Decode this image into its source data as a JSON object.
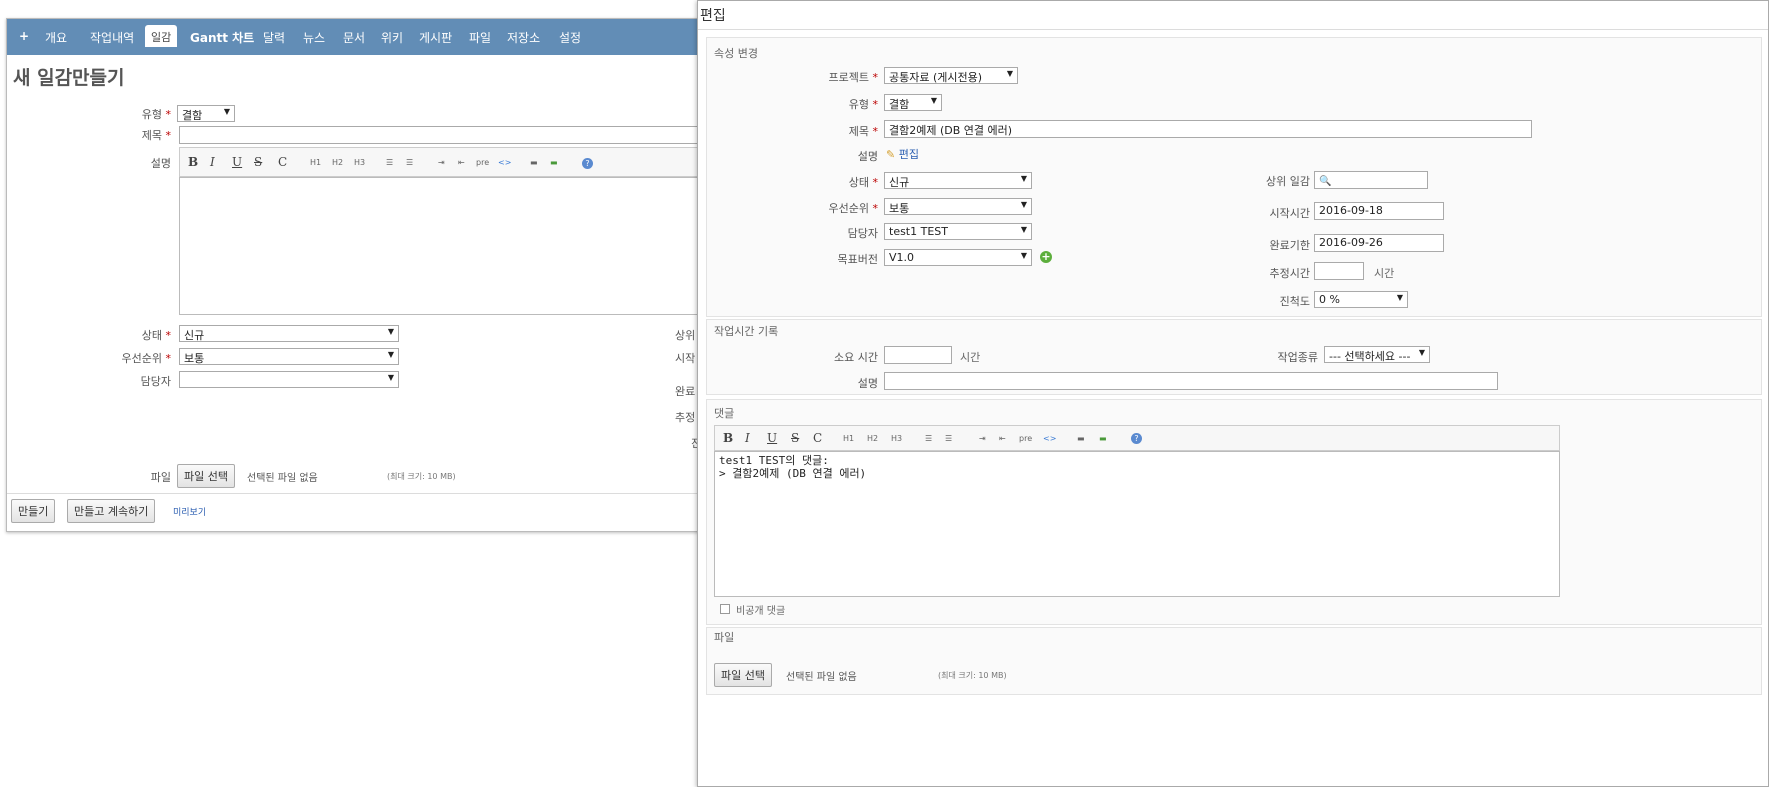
{
  "left_window": {
    "menu": {
      "plus": "+",
      "items": [
        "개요",
        "작업내역",
        "일감",
        "Gantt 차트",
        "달력",
        "뉴스",
        "문서",
        "위키",
        "게시판",
        "파일",
        "저장소",
        "설정"
      ]
    },
    "title": "새 일감만들기",
    "form": {
      "type_label": "유형",
      "type_value": "결함",
      "subject_label": "제목",
      "subject_value": "",
      "description_label": "설명",
      "status_label": "상태",
      "status_value": "신규",
      "priority_label": "우선순위",
      "priority_value": "보통",
      "assignee_label": "담당자",
      "assignee_value": "",
      "right_labels_cut": [
        "상위",
        "시작",
        "완료",
        "추정",
        "진"
      ],
      "file_label": "파일",
      "file_button": "파일 선택",
      "no_file": "선택된 파일 없음",
      "max_size": "(최대 크기: 10 MB)"
    },
    "buttons": {
      "create": "만들기",
      "create_continue": "만들고 계속하기",
      "preview": "미리보기"
    }
  },
  "right_window": {
    "title": "편집",
    "section_attrs": "속성 변경",
    "project_label": "프로젝트",
    "project_value": "공통자료 (게시전용)",
    "type_label": "유형",
    "type_value": "결함",
    "subject_label": "제목",
    "subject_value": "결함2예제 (DB 연결 에러)",
    "desc_label": "설명",
    "desc_edit": "편집",
    "status_label": "상태",
    "status_value": "신규",
    "priority_label": "우선순위",
    "priority_value": "보통",
    "assignee_label": "담당자",
    "assignee_value": "test1 TEST",
    "version_label": "목표버전",
    "version_value": "V1.0",
    "parent_label": "상위 일감",
    "parent_value": "",
    "start_label": "시작시간",
    "start_value": "2016-09-18",
    "due_label": "완료기한",
    "due_value": "2016-09-26",
    "estimate_label": "추정시간",
    "estimate_value": "",
    "estimate_unit": "시간",
    "done_label": "진척도",
    "done_value": "0 %",
    "section_time": "작업시간 기록",
    "spent_label": "소요 시간",
    "spent_value": "",
    "spent_unit": "시간",
    "activity_label": "작업종류",
    "activity_value": "--- 선택하세요 ---",
    "comment_label": "설명",
    "comment_value": "",
    "section_notes": "댓글",
    "notes_lines": [
      "test1 TEST의 댓글:",
      "> 결함2예제 (DB 연결 에러)"
    ],
    "private_label": "비공개 댓글",
    "section_files": "파일",
    "file_button": "파일 선택",
    "no_file": "선택된 파일 없음",
    "max_size": "(최대 크기: 10 MB)"
  },
  "toolbar": {
    "bold": "B",
    "italic": "I",
    "underline": "U",
    "strike": "S",
    "code": "C",
    "h1": "H1",
    "h2": "H2",
    "h3": "H3",
    "ul": "☰",
    "ol": "☰",
    "indent": "⇥",
    "outdent": "⇤",
    "pre": "pre",
    "link": "<>",
    "img": "▬",
    "img2": "▬",
    "help": "?"
  },
  "colors": {
    "menubar": "#628db6",
    "required": "#bb0000",
    "link": "#2a5db0"
  }
}
